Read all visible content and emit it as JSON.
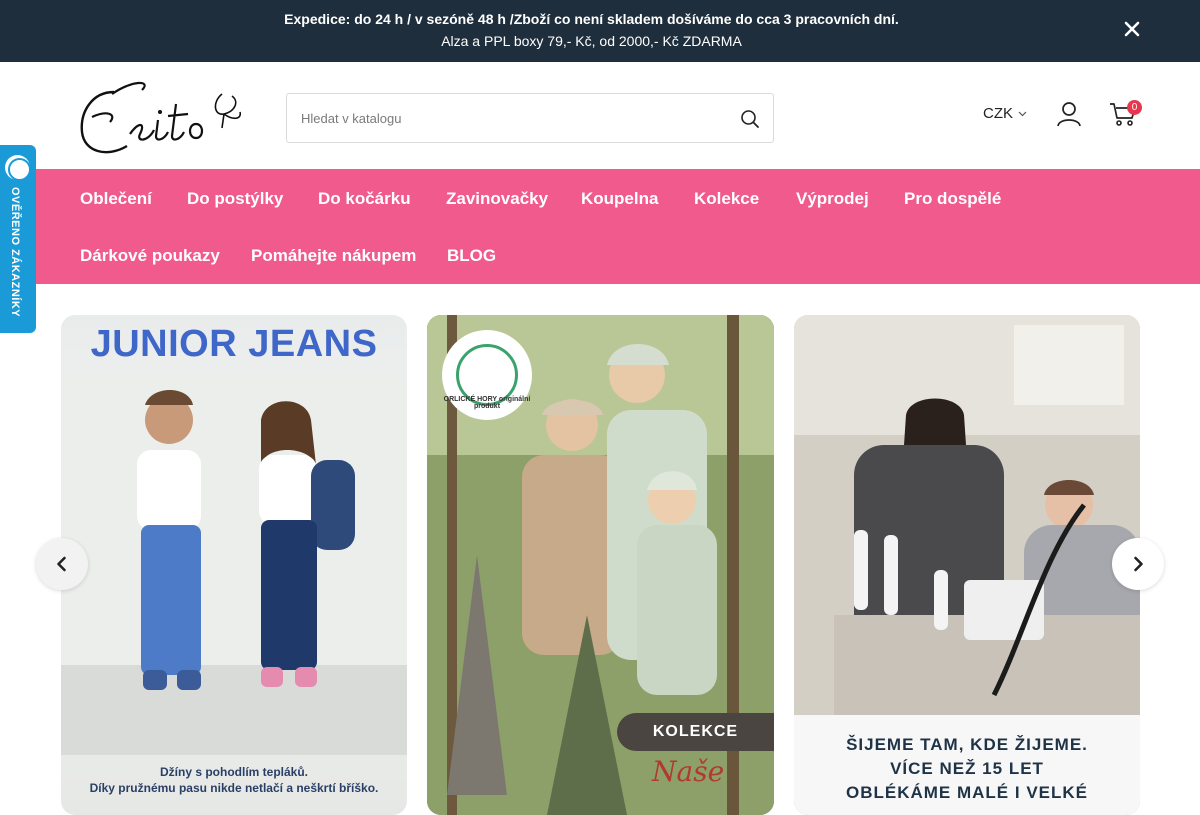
{
  "topbar": {
    "line1": "Expedice: do 24 h / v sezóně 48 h /Zboží co není skladem došíváme do cca 3 pracovních dní.",
    "line2": "Alza a PPL boxy 79,- Kč, od 2000,- Kč ZDARMA",
    "close_icon": "close-icon"
  },
  "header": {
    "logo_text": "Esito",
    "search": {
      "placeholder": "Hledat v katalogu",
      "value": "",
      "icon": "search-icon"
    },
    "currency": "CZK",
    "user_icon": "user-icon",
    "cart_icon": "cart-icon",
    "cart_count": "0"
  },
  "nav": {
    "items": [
      {
        "label": "Oblečení"
      },
      {
        "label": "Do postýlky"
      },
      {
        "label": "Do kočárku"
      },
      {
        "label": "Zavinovačky"
      },
      {
        "label": "Koupelna"
      },
      {
        "label": "Kolekce"
      },
      {
        "label": "Výprodej"
      },
      {
        "label": "Pro dospělé"
      },
      {
        "label": "Dárkové poukazy"
      },
      {
        "label": "Pomáhejte nákupem"
      },
      {
        "label": "BLOG"
      }
    ]
  },
  "side_badge": {
    "text": "OVĚŘENO ZÁKAZNÍKY"
  },
  "slides": [
    {
      "title": "JUNIOR JEANS",
      "caption1": "Džíny s pohodlím tepláků.",
      "caption2": "Díky pružnému pasu nikde netlačí a neškrtí bříško."
    },
    {
      "seal_text": "ORLICKÉ HORY originální produkt",
      "tag": "KOLEKCE",
      "script": "Naše"
    },
    {
      "line1": "ŠIJEME TAM, KDE ŽIJEME.",
      "line2": "VÍCE NEŽ 15 LET",
      "line3": "OBLÉKÁME MALÉ I VELKÉ"
    }
  ],
  "carousel": {
    "prev_icon": "chevron-left-icon",
    "next_icon": "chevron-right-icon"
  },
  "colors": {
    "topbar": "#1f2e3d",
    "nav": "#f05a8c",
    "side_badge": "#1a9bd7",
    "cart_badge": "#e8364f"
  }
}
